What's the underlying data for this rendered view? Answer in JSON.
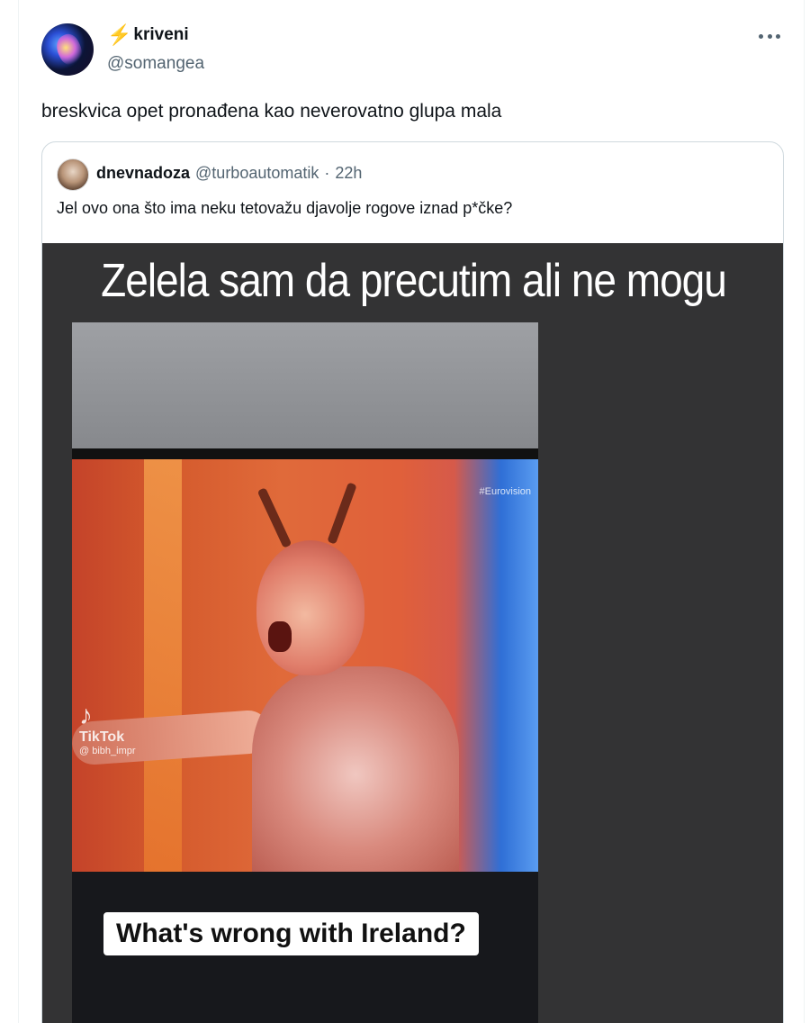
{
  "author": {
    "display_name": "kriveni",
    "name_icon": "lightning-emoji",
    "name_prefix_glyph": "⚡",
    "handle": "@somangea"
  },
  "tweet": {
    "text": "breskvica opet pronađena kao neverovatno glupa mala"
  },
  "quoted_tweet": {
    "display_name": "dnevnadoza",
    "handle": "@turboautomatik",
    "separator": "·",
    "time": "22h",
    "text": "Jel ovo ona što ima neku tetovažu djavolje rogove iznad p*čke?",
    "media": {
      "caption_top": "Zelela sam da precutim ali ne mogu",
      "caption_bottom": "What's wrong with Ireland?",
      "tiktok_label": "TikTok",
      "tiktok_user": "@ bibh_impr"
    }
  },
  "colors": {
    "text_primary": "#0f1419",
    "text_secondary": "#536471",
    "border": "#cfd9de",
    "media_background": "#333334"
  }
}
